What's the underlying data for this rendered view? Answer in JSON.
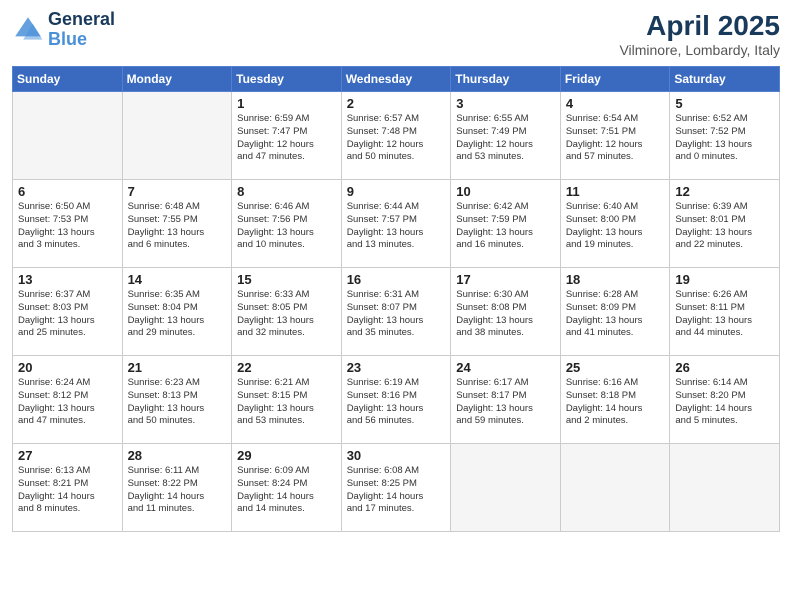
{
  "header": {
    "logo_line1": "General",
    "logo_line2": "Blue",
    "title": "April 2025",
    "subtitle": "Vilminore, Lombardy, Italy"
  },
  "weekdays": [
    "Sunday",
    "Monday",
    "Tuesday",
    "Wednesday",
    "Thursday",
    "Friday",
    "Saturday"
  ],
  "weeks": [
    [
      {
        "day": "",
        "detail": ""
      },
      {
        "day": "",
        "detail": ""
      },
      {
        "day": "1",
        "detail": "Sunrise: 6:59 AM\nSunset: 7:47 PM\nDaylight: 12 hours\nand 47 minutes."
      },
      {
        "day": "2",
        "detail": "Sunrise: 6:57 AM\nSunset: 7:48 PM\nDaylight: 12 hours\nand 50 minutes."
      },
      {
        "day": "3",
        "detail": "Sunrise: 6:55 AM\nSunset: 7:49 PM\nDaylight: 12 hours\nand 53 minutes."
      },
      {
        "day": "4",
        "detail": "Sunrise: 6:54 AM\nSunset: 7:51 PM\nDaylight: 12 hours\nand 57 minutes."
      },
      {
        "day": "5",
        "detail": "Sunrise: 6:52 AM\nSunset: 7:52 PM\nDaylight: 13 hours\nand 0 minutes."
      }
    ],
    [
      {
        "day": "6",
        "detail": "Sunrise: 6:50 AM\nSunset: 7:53 PM\nDaylight: 13 hours\nand 3 minutes."
      },
      {
        "day": "7",
        "detail": "Sunrise: 6:48 AM\nSunset: 7:55 PM\nDaylight: 13 hours\nand 6 minutes."
      },
      {
        "day": "8",
        "detail": "Sunrise: 6:46 AM\nSunset: 7:56 PM\nDaylight: 13 hours\nand 10 minutes."
      },
      {
        "day": "9",
        "detail": "Sunrise: 6:44 AM\nSunset: 7:57 PM\nDaylight: 13 hours\nand 13 minutes."
      },
      {
        "day": "10",
        "detail": "Sunrise: 6:42 AM\nSunset: 7:59 PM\nDaylight: 13 hours\nand 16 minutes."
      },
      {
        "day": "11",
        "detail": "Sunrise: 6:40 AM\nSunset: 8:00 PM\nDaylight: 13 hours\nand 19 minutes."
      },
      {
        "day": "12",
        "detail": "Sunrise: 6:39 AM\nSunset: 8:01 PM\nDaylight: 13 hours\nand 22 minutes."
      }
    ],
    [
      {
        "day": "13",
        "detail": "Sunrise: 6:37 AM\nSunset: 8:03 PM\nDaylight: 13 hours\nand 25 minutes."
      },
      {
        "day": "14",
        "detail": "Sunrise: 6:35 AM\nSunset: 8:04 PM\nDaylight: 13 hours\nand 29 minutes."
      },
      {
        "day": "15",
        "detail": "Sunrise: 6:33 AM\nSunset: 8:05 PM\nDaylight: 13 hours\nand 32 minutes."
      },
      {
        "day": "16",
        "detail": "Sunrise: 6:31 AM\nSunset: 8:07 PM\nDaylight: 13 hours\nand 35 minutes."
      },
      {
        "day": "17",
        "detail": "Sunrise: 6:30 AM\nSunset: 8:08 PM\nDaylight: 13 hours\nand 38 minutes."
      },
      {
        "day": "18",
        "detail": "Sunrise: 6:28 AM\nSunset: 8:09 PM\nDaylight: 13 hours\nand 41 minutes."
      },
      {
        "day": "19",
        "detail": "Sunrise: 6:26 AM\nSunset: 8:11 PM\nDaylight: 13 hours\nand 44 minutes."
      }
    ],
    [
      {
        "day": "20",
        "detail": "Sunrise: 6:24 AM\nSunset: 8:12 PM\nDaylight: 13 hours\nand 47 minutes."
      },
      {
        "day": "21",
        "detail": "Sunrise: 6:23 AM\nSunset: 8:13 PM\nDaylight: 13 hours\nand 50 minutes."
      },
      {
        "day": "22",
        "detail": "Sunrise: 6:21 AM\nSunset: 8:15 PM\nDaylight: 13 hours\nand 53 minutes."
      },
      {
        "day": "23",
        "detail": "Sunrise: 6:19 AM\nSunset: 8:16 PM\nDaylight: 13 hours\nand 56 minutes."
      },
      {
        "day": "24",
        "detail": "Sunrise: 6:17 AM\nSunset: 8:17 PM\nDaylight: 13 hours\nand 59 minutes."
      },
      {
        "day": "25",
        "detail": "Sunrise: 6:16 AM\nSunset: 8:18 PM\nDaylight: 14 hours\nand 2 minutes."
      },
      {
        "day": "26",
        "detail": "Sunrise: 6:14 AM\nSunset: 8:20 PM\nDaylight: 14 hours\nand 5 minutes."
      }
    ],
    [
      {
        "day": "27",
        "detail": "Sunrise: 6:13 AM\nSunset: 8:21 PM\nDaylight: 14 hours\nand 8 minutes."
      },
      {
        "day": "28",
        "detail": "Sunrise: 6:11 AM\nSunset: 8:22 PM\nDaylight: 14 hours\nand 11 minutes."
      },
      {
        "day": "29",
        "detail": "Sunrise: 6:09 AM\nSunset: 8:24 PM\nDaylight: 14 hours\nand 14 minutes."
      },
      {
        "day": "30",
        "detail": "Sunrise: 6:08 AM\nSunset: 8:25 PM\nDaylight: 14 hours\nand 17 minutes."
      },
      {
        "day": "",
        "detail": ""
      },
      {
        "day": "",
        "detail": ""
      },
      {
        "day": "",
        "detail": ""
      }
    ]
  ]
}
